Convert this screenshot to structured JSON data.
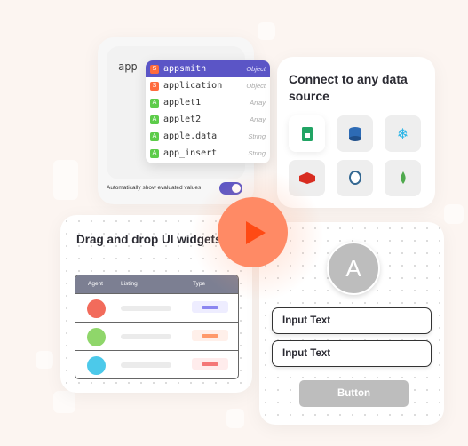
{
  "editor": {
    "typed": "app",
    "options": [
      {
        "badge": "S",
        "label": "appsmith",
        "type": "Object",
        "color": "#ff6b3d"
      },
      {
        "badge": "S",
        "label": "application",
        "type": "Object",
        "color": "#ff6b3d"
      },
      {
        "badge": "A",
        "label": "applet1",
        "type": "Array",
        "color": "#5dcc4a"
      },
      {
        "badge": "A",
        "label": "applet2",
        "type": "Array",
        "color": "#5dcc4a"
      },
      {
        "badge": "A",
        "label": "apple.data",
        "type": "String",
        "color": "#5dcc4a"
      },
      {
        "badge": "A",
        "label": "app_insert",
        "type": "String",
        "color": "#5dcc4a"
      }
    ],
    "auto_label": "Automatically show evaluated values",
    "toggle_on": true
  },
  "datasource": {
    "title": "Connect to any data source",
    "icons": [
      "google-sheets-icon",
      "database-icon",
      "snowflake-icon",
      "redis-icon",
      "postgres-icon",
      "mongodb-icon"
    ]
  },
  "dragdrop": {
    "title": "Drag and drop UI widgets",
    "columns": [
      "Agent",
      "Listing",
      "Type"
    ],
    "rows": [
      {
        "avatar": "#f26b5b",
        "type_color": "#8b86f0",
        "type_bg": "#eeedff"
      },
      {
        "avatar": "#8fd66a",
        "type_color": "#ff9a6b",
        "type_bg": "#fff0ea"
      },
      {
        "avatar": "#4cc9ea",
        "type_color": "#f47777",
        "type_bg": "#ffecec"
      }
    ]
  },
  "widgets": {
    "avatar_letter": "A",
    "input1": "Input Text",
    "input2": "Input Text",
    "button": "Button"
  },
  "accent": "#5b55c6",
  "play_color": "#ff4a14"
}
